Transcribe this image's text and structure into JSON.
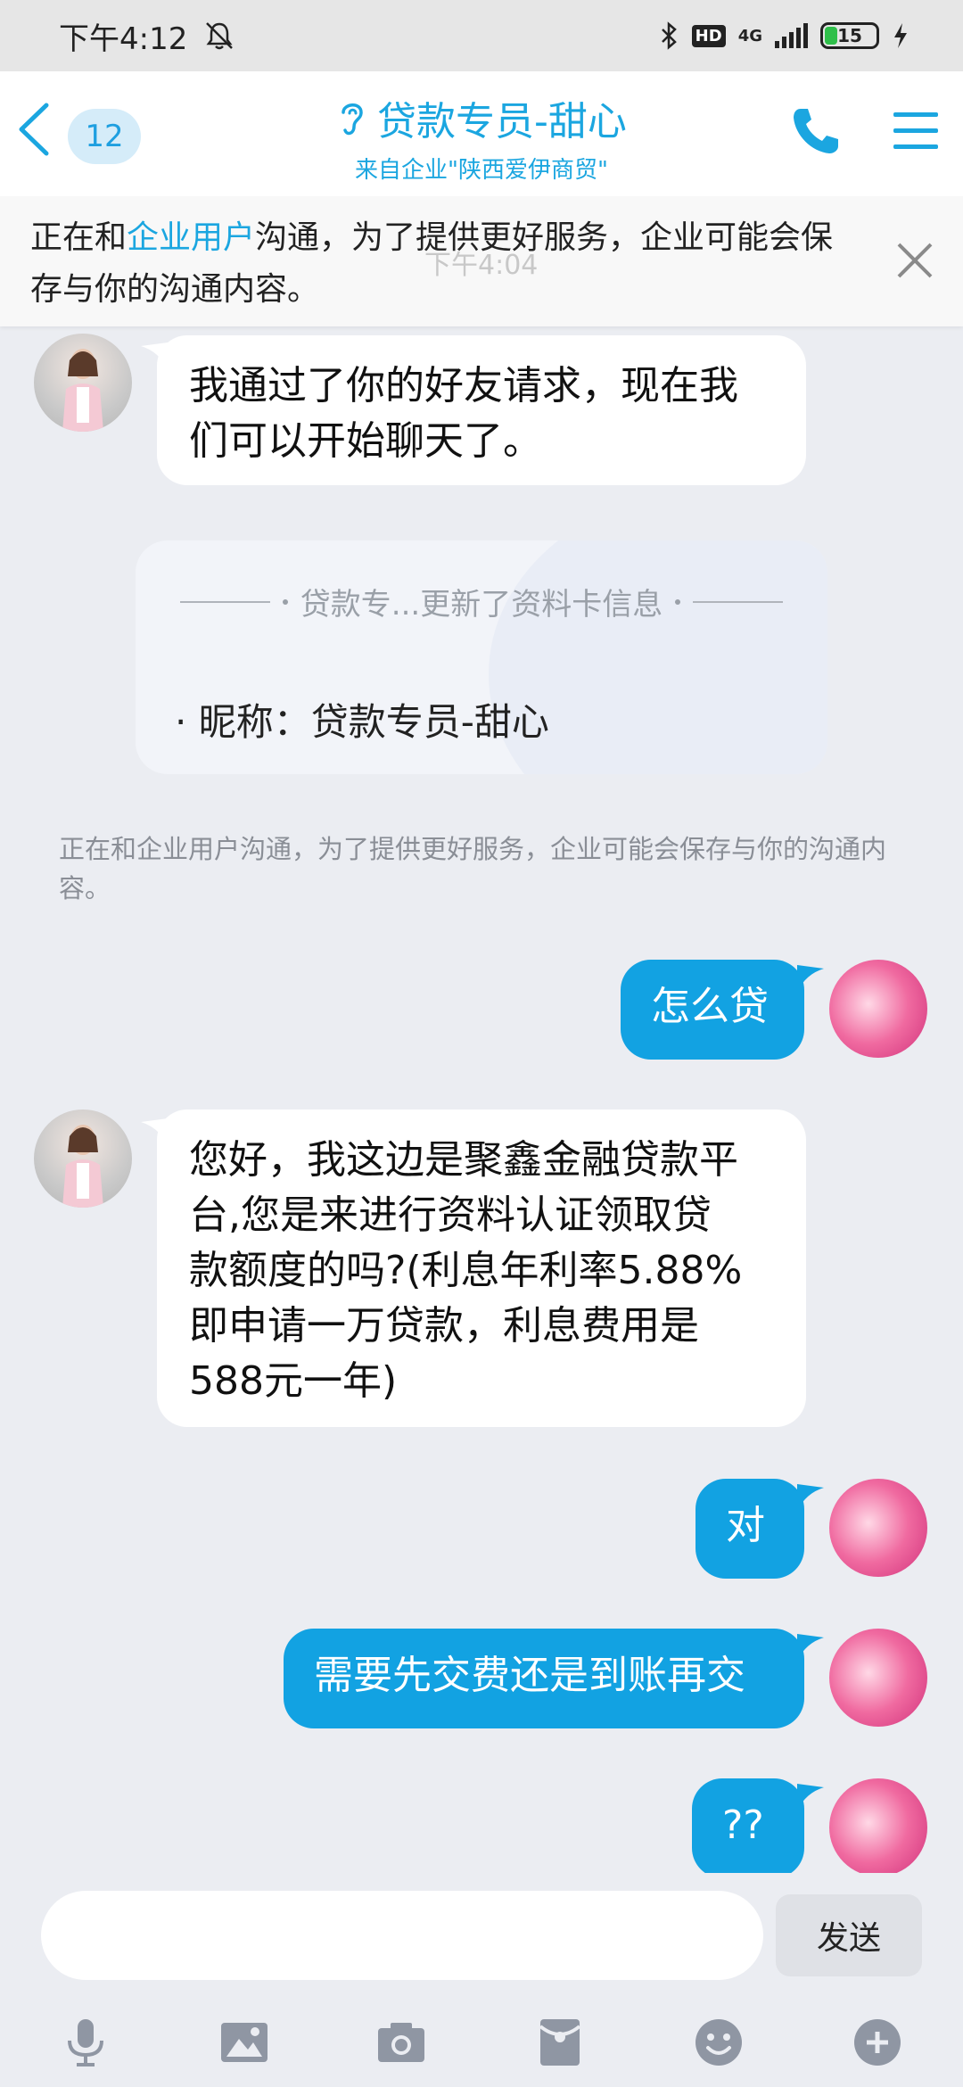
{
  "status_bar": {
    "time": "下午4:12",
    "network": "4G",
    "hd_label": "HD",
    "battery": "15"
  },
  "header": {
    "unread_count": "12",
    "title": "贷款专员-甜心",
    "subtitle": "来自企业\"陕西爱伊商贸\""
  },
  "notice": {
    "prefix": "正在和",
    "highlight": "企业用户",
    "suffix": "沟通，为了提供更好服务，企业可能会保存与你的沟通内容。",
    "faded_time": "下午4:04"
  },
  "messages": [
    {
      "side": "in",
      "text_lines": [
        "我通过了你的好友请求，现在我",
        "们可以开始聊天了。"
      ]
    },
    {
      "side": "out",
      "text": "怎么贷"
    },
    {
      "side": "in",
      "text_lines": [
        "您好，我这边是聚鑫金融贷款平",
        "台,您是来进行资料认证领取贷",
        "款额度的吗?(利息年利率5.88%",
        "即申请一万贷款，利息费用是",
        "588元一年)"
      ]
    },
    {
      "side": "out",
      "text": "对"
    },
    {
      "side": "out",
      "text": "需要先交费还是到账再交"
    },
    {
      "side": "out",
      "text": "??"
    }
  ],
  "profile_card": {
    "title": "贷款专...更新了资料卡信息",
    "item": "· 昵称：贷款专员-甜心"
  },
  "system_tip": "正在和企业用户沟通，为了提供更好服务，企业可能会保存与你的沟通内容。",
  "input": {
    "value": "",
    "send_label": "发送"
  },
  "colors": {
    "accent": "#1ba6e0",
    "bubble_out": "#12a2e2",
    "background": "#ebedf2"
  },
  "toolbar_icons": [
    "microphone-icon",
    "image-icon",
    "camera-icon",
    "red-packet-icon",
    "emoji-icon",
    "plus-icon"
  ]
}
